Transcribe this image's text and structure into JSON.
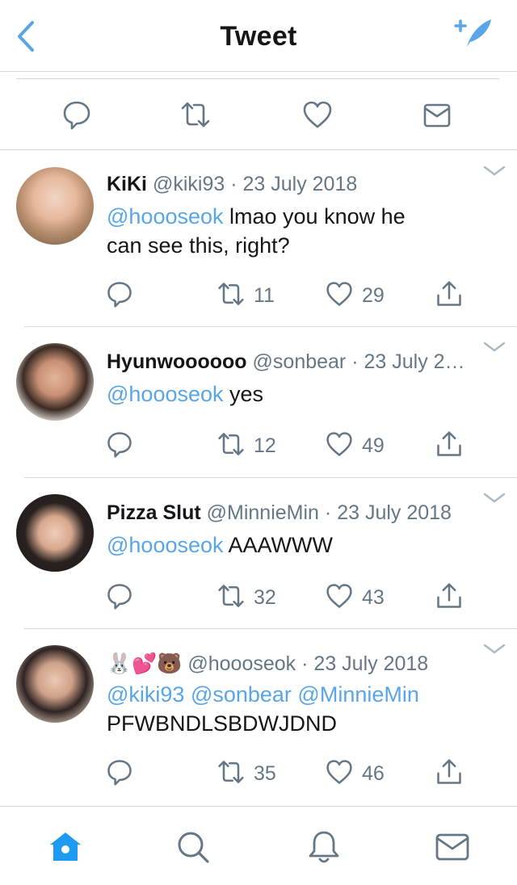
{
  "nav": {
    "title": "Tweet"
  },
  "replies": [
    {
      "name": "KiKi",
      "handle": "@kiki93",
      "date": "23 July 2018",
      "mentions": "@hoooseok",
      "text": " lmao you know he",
      "text2": "can see this, right?",
      "retweets": "11",
      "likes": "29"
    },
    {
      "name": "Hyunwoooooo",
      "handle": "@sonbear",
      "date": "23 July 2…",
      "mentions": "@hoooseok",
      "text": " yes",
      "retweets": "12",
      "likes": "49"
    },
    {
      "name": "Pizza Slut",
      "handle": "@MinnieMin",
      "date": "23 July 2018",
      "mentions": "@hoooseok",
      "text": " AAAWWW",
      "retweets": "32",
      "likes": "43"
    },
    {
      "name_emoji": [
        "🐰",
        "💕",
        "🐻"
      ],
      "handle": "@hoooseok",
      "date": "23 July 2018",
      "mentions": "@kiki93 @sonbear @MinnieMin",
      "text": "PFWBNDLSBDWJDND",
      "retweets": "35",
      "likes": "46"
    }
  ],
  "colors": {
    "accent": "#58a5e8",
    "meta": "#657786",
    "divider": "#d8d8d8"
  },
  "icons": [
    "back-icon",
    "compose-icon",
    "reply-icon",
    "retweet-icon",
    "like-icon",
    "dm-icon",
    "share-icon",
    "chevron-down-icon",
    "home-icon",
    "search-icon",
    "notifications-icon",
    "messages-icon"
  ]
}
